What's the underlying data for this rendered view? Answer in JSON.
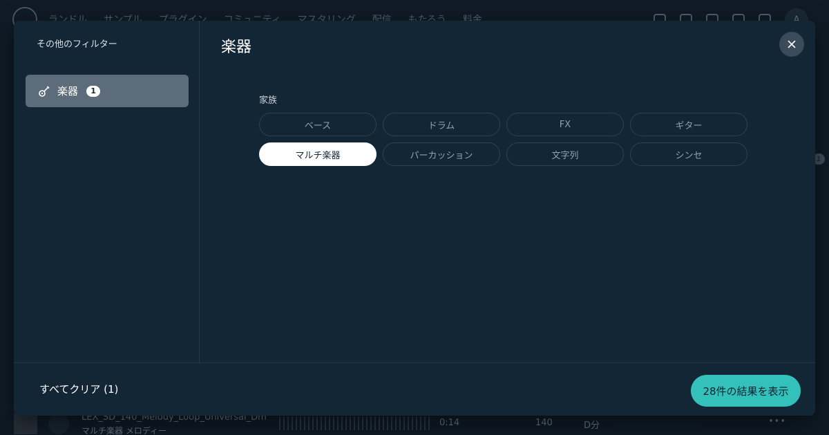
{
  "background": {
    "nav_items": [
      "ランドル",
      "サンプル",
      "プラグイン",
      "コミュニティ",
      "マスタリング",
      "配信",
      "もたろう",
      "料金"
    ],
    "avatar_letter": "A",
    "right_badge": "1",
    "player": {
      "title": "LEX_SD_140_Melody_Loop_Universal_Dm",
      "subtitle": "マルチ楽器  メロディー",
      "time": "0:14",
      "bpm": "140",
      "key": "D分",
      "more": "•••"
    }
  },
  "modal": {
    "sidebar": {
      "title": "その他のフィルター",
      "items": [
        {
          "label": "楽器",
          "count": "1",
          "icon": "guitar-icon"
        }
      ]
    },
    "content": {
      "title": "楽器",
      "group_label": "家族",
      "chips": [
        {
          "label": "ベース",
          "selected": false
        },
        {
          "label": "ドラム",
          "selected": false
        },
        {
          "label": "FX",
          "selected": false
        },
        {
          "label": "ギター",
          "selected": false
        },
        {
          "label": "マルチ楽器",
          "selected": true
        },
        {
          "label": "パーカッション",
          "selected": false
        },
        {
          "label": "文字列",
          "selected": false
        },
        {
          "label": "シンセ",
          "selected": false
        }
      ]
    },
    "footer": {
      "clear_label": "すべてクリア (1)",
      "show_results_label": "28件の結果を表示"
    }
  },
  "colors": {
    "accent": "#35c1bb",
    "modal_bg": "#132636",
    "selected_item_bg": "#5d6c7a"
  }
}
